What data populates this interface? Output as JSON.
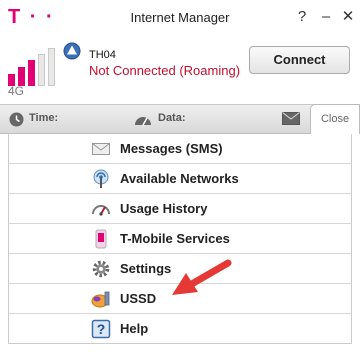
{
  "window": {
    "brand": "T · ·",
    "title": "Internet Manager",
    "help_label": "?",
    "minimize_label": "–",
    "close_label": "✕"
  },
  "status": {
    "network_type": "4G",
    "network_name": "TH04",
    "connection_status": "Not Connected (Roaming)",
    "connect_label": "Connect",
    "signal_bars_lit": 3,
    "signal_bars_total": 5
  },
  "infobar": {
    "time_label": "Time:",
    "data_label": "Data:",
    "close_tab_label": "Close"
  },
  "menu": {
    "items": [
      {
        "label": "Messages (SMS)",
        "icon": "envelope-icon"
      },
      {
        "label": "Available Networks",
        "icon": "antenna-icon"
      },
      {
        "label": "Usage History",
        "icon": "gauge-icon"
      },
      {
        "label": "T-Mobile Services",
        "icon": "phone-icon"
      },
      {
        "label": "Settings",
        "icon": "gear-icon"
      },
      {
        "label": "USSD",
        "icon": "ussd-icon"
      },
      {
        "label": "Help",
        "icon": "help-icon"
      }
    ]
  },
  "colors": {
    "brand": "#e20074",
    "status_error": "#c0102e",
    "annotation_arrow": "#e53935"
  }
}
